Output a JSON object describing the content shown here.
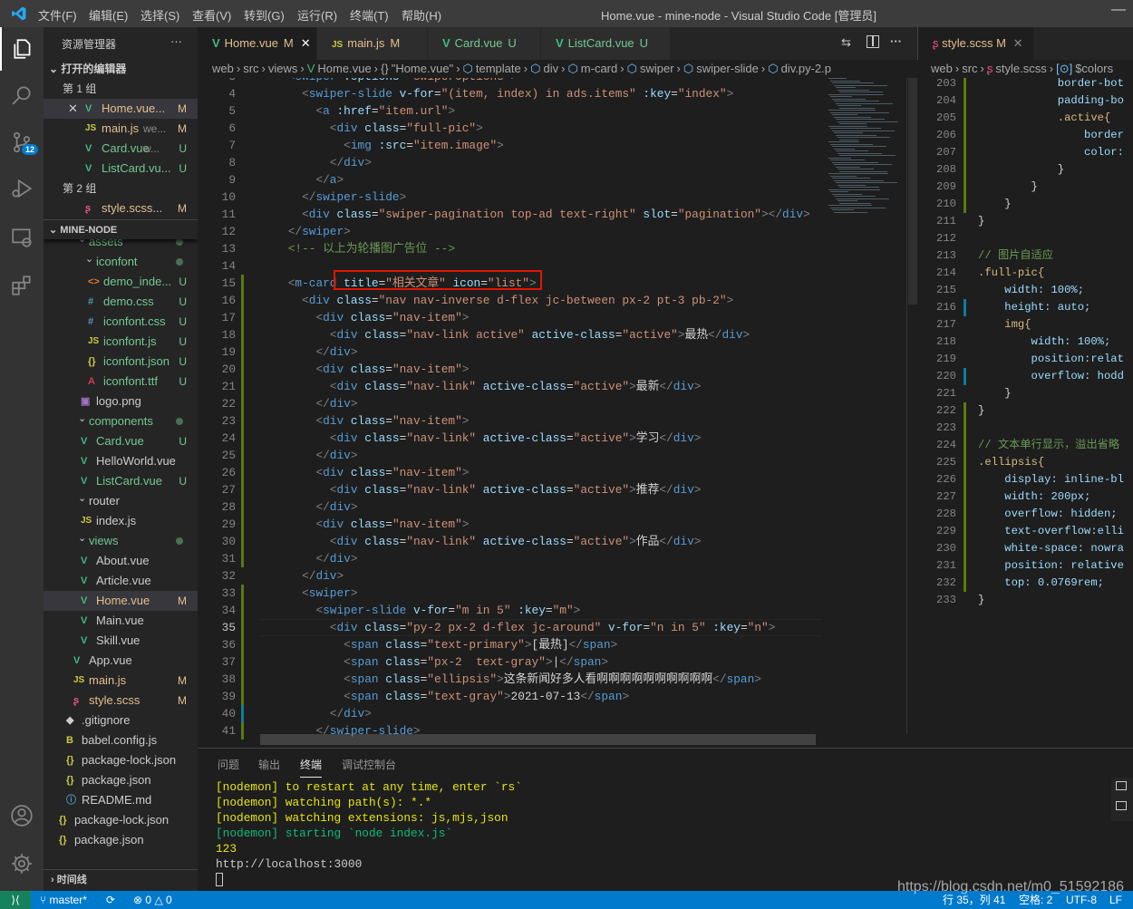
{
  "titlebar": {
    "title": "Home.vue - mine-node - Visual Studio Code [管理员]",
    "menus": [
      "文件(F)",
      "编辑(E)",
      "选择(S)",
      "查看(V)",
      "转到(G)",
      "运行(R)",
      "终端(T)",
      "帮助(H)"
    ]
  },
  "activity": {
    "scm_badge": "12"
  },
  "sidebar": {
    "title": "资源管理器",
    "more": "···",
    "open_editors_title": "打开的编辑器",
    "groups": [
      {
        "label": "第 1 组",
        "items": [
          {
            "label": "Home.vue...",
            "desc": "",
            "icon": "vue",
            "status": "M",
            "color": "mod",
            "active": true
          },
          {
            "label": "main.js",
            "desc": "we...",
            "icon": "js",
            "status": "M",
            "color": "mod"
          },
          {
            "label": "Card.vue",
            "desc": "w...",
            "icon": "vue",
            "status": "U",
            "color": "unt"
          },
          {
            "label": "ListCard.vu...",
            "desc": "",
            "icon": "vue",
            "status": "U",
            "color": "unt"
          }
        ]
      },
      {
        "label": "第 2 组",
        "items": [
          {
            "label": "style.scss...",
            "desc": "",
            "icon": "scss",
            "status": "M",
            "color": "mod"
          }
        ]
      }
    ],
    "project_title": "MINE-NODE",
    "tree": [
      {
        "label": "assets",
        "depth": 1,
        "folder": true,
        "status": "dot",
        "color": "unt"
      },
      {
        "label": "iconfont",
        "depth": 2,
        "folder": true,
        "status": "dot",
        "color": "unt"
      },
      {
        "label": "demo_inde...",
        "depth": 3,
        "icon": "html",
        "status": "U",
        "color": "unt"
      },
      {
        "label": "demo.css",
        "depth": 3,
        "icon": "css",
        "status": "U",
        "color": "unt"
      },
      {
        "label": "iconfont.css",
        "depth": 3,
        "icon": "css",
        "status": "U",
        "color": "unt"
      },
      {
        "label": "iconfont.js",
        "depth": 3,
        "icon": "js",
        "status": "U",
        "color": "unt"
      },
      {
        "label": "iconfont.json",
        "depth": 3,
        "icon": "json",
        "status": "U",
        "color": "unt"
      },
      {
        "label": "iconfont.ttf",
        "depth": 3,
        "icon": "font",
        "status": "U",
        "color": "unt"
      },
      {
        "label": "logo.png",
        "depth": 2,
        "icon": "img",
        "status": "",
        "color": ""
      },
      {
        "label": "components",
        "depth": 1,
        "folder": true,
        "status": "dot",
        "color": "unt"
      },
      {
        "label": "Card.vue",
        "depth": 2,
        "icon": "vue",
        "status": "U",
        "color": "unt"
      },
      {
        "label": "HelloWorld.vue",
        "depth": 2,
        "icon": "vue",
        "status": "",
        "color": ""
      },
      {
        "label": "ListCard.vue",
        "depth": 2,
        "icon": "vue",
        "status": "U",
        "color": "unt"
      },
      {
        "label": "router",
        "depth": 1,
        "folder": true,
        "status": "",
        "color": ""
      },
      {
        "label": "index.js",
        "depth": 2,
        "icon": "js",
        "status": "",
        "color": ""
      },
      {
        "label": "views",
        "depth": 1,
        "folder": true,
        "status": "dot",
        "color": "unt"
      },
      {
        "label": "About.vue",
        "depth": 2,
        "icon": "vue",
        "status": "",
        "color": ""
      },
      {
        "label": "Article.vue",
        "depth": 2,
        "icon": "vue",
        "status": "",
        "color": ""
      },
      {
        "label": "Home.vue",
        "depth": 2,
        "icon": "vue",
        "status": "M",
        "color": "mod",
        "selected": true
      },
      {
        "label": "Main.vue",
        "depth": 2,
        "icon": "vue",
        "status": "",
        "color": ""
      },
      {
        "label": "Skill.vue",
        "depth": 2,
        "icon": "vue",
        "status": "",
        "color": ""
      },
      {
        "label": "App.vue",
        "depth": 1,
        "icon": "vue",
        "status": "",
        "color": ""
      },
      {
        "label": "main.js",
        "depth": 1,
        "icon": "js",
        "status": "M",
        "color": "mod"
      },
      {
        "label": "style.scss",
        "depth": 1,
        "icon": "scss",
        "status": "M",
        "color": "mod"
      },
      {
        "label": ".gitignore",
        "depth": 0,
        "icon": "git",
        "status": "",
        "color": ""
      },
      {
        "label": "babel.config.js",
        "depth": 0,
        "icon": "babel",
        "status": "",
        "color": ""
      },
      {
        "label": "package-lock.json",
        "depth": 0,
        "icon": "json",
        "status": "",
        "color": ""
      },
      {
        "label": "package.json",
        "depth": 0,
        "icon": "json",
        "status": "",
        "color": ""
      },
      {
        "label": "README.md",
        "depth": 0,
        "icon": "md",
        "status": "",
        "color": ""
      },
      {
        "label": "package-lock.json",
        "depth": -1,
        "icon": "json",
        "status": "",
        "color": ""
      },
      {
        "label": "package.json",
        "depth": -1,
        "icon": "json",
        "status": "",
        "color": ""
      }
    ],
    "timeline_title": "时间线"
  },
  "editor1": {
    "tabs": [
      {
        "label": "Home.vue",
        "status": "M",
        "icon": "vue",
        "color": "mod",
        "active": true
      },
      {
        "label": "main.js",
        "status": "M",
        "icon": "js",
        "color": "mod"
      },
      {
        "label": "Card.vue",
        "status": "U",
        "icon": "vue",
        "color": "unt"
      },
      {
        "label": "ListCard.vue",
        "status": "U",
        "icon": "vue",
        "color": "unt"
      }
    ],
    "breadcrumbs": [
      "web",
      "src",
      "views",
      "Home.vue",
      "\"Home.vue\"",
      "template",
      "div",
      "m-card",
      "swiper",
      "swiper-slide",
      "div.py-2.p"
    ],
    "first_line": 3,
    "current_line": 35,
    "lines": [
      "    <swiper :options=\"swiperOptions\">",
      "      <swiper-slide v-for=\"(item, index) in ads.items\" :key=\"index\">",
      "        <a :href=\"item.url\">",
      "          <div class=\"full-pic\">",
      "            <img :src=\"item.image\">",
      "          </div>",
      "        </a>",
      "      </swiper-slide>",
      "      <div class=\"swiper-pagination top-ad text-right\" slot=\"pagination\"></div>",
      "    </swiper>",
      "    <!-- 以上为轮播图广告位 -->",
      "",
      "    <m-card title=\"相关文章\" icon=\"list\">",
      "      <div class=\"nav nav-inverse d-flex jc-between px-2 pt-3 pb-2\">",
      "        <div class=\"nav-item\">",
      "          <div class=\"nav-link active\" active-class=\"active\">最热</div>",
      "        </div>",
      "        <div class=\"nav-item\">",
      "          <div class=\"nav-link\" active-class=\"active\">最新</div>",
      "        </div>",
      "        <div class=\"nav-item\">",
      "          <div class=\"nav-link\" active-class=\"active\">学习</div>",
      "        </div>",
      "        <div class=\"nav-item\">",
      "          <div class=\"nav-link\" active-class=\"active\">推荐</div>",
      "        </div>",
      "        <div class=\"nav-item\">",
      "          <div class=\"nav-link\" active-class=\"active\">作品</div>",
      "        </div>",
      "      </div>",
      "      <swiper>",
      "        <swiper-slide v-for=\"m in 5\" :key=\"m\">",
      "          <div class=\"py-2 px-2 d-flex jc-around\" v-for=\"n in 5\" :key=\"n\">",
      "            <span class=\"text-primary\">[最热]</span>",
      "            <span class=\"px-2  text-gray\">|</span>",
      "            <span class=\"ellipsis\">这条新闻好多人看啊啊啊啊啊啊啊啊啊啊</span>",
      "            <span class=\"text-gray\">2021-07-13</span>",
      "          </div>",
      "        </swiper-slide>"
    ],
    "highlight_box_text": " title=\"相关文章\" icon=\"list\">",
    "highlight_color": "#e51400"
  },
  "editor2": {
    "tab": {
      "label": "style.scss",
      "status": "M",
      "icon": "scss",
      "color": "mod"
    },
    "breadcrumbs": [
      "web",
      "src",
      "style.scss",
      "$colors"
    ],
    "first_line": 203,
    "lines": [
      "            border-bot",
      "            padding-bo",
      "            .active{",
      "                border",
      "                color:",
      "            }",
      "        }",
      "    }",
      "}",
      "",
      "// 图片自适应",
      ".full-pic{",
      "    width: 100%;",
      "    height: auto;",
      "    img{",
      "        width: 100%;",
      "        position:relat",
      "        overflow: hodd",
      "    }",
      "}",
      "",
      "// 文本单行显示，溢出省略",
      ".ellipsis{",
      "    display: inline-bl",
      "    width: 200px;",
      "    overflow: hidden;",
      "    text-overflow:elli",
      "    white-space: nowra",
      "    position: relative",
      "    top: 0.0769rem;",
      "}"
    ]
  },
  "panel": {
    "tabs": [
      "问题",
      "输出",
      "终端",
      "调试控制台"
    ],
    "active_tab": "终端",
    "terminal": [
      {
        "text": "[nodemon] to restart at any time, enter `rs`",
        "color": "#e5e510"
      },
      {
        "text": "[nodemon] watching path(s): *.*",
        "color": "#e5e510"
      },
      {
        "text": "[nodemon] watching extensions: js,mjs,json",
        "color": "#e5e510"
      },
      {
        "text": "[nodemon] starting `node index.js`",
        "color": "#0dbc79"
      },
      {
        "text": "123",
        "color": "#e5e510"
      },
      {
        "text": "http://localhost:3000",
        "color": "#cccccc"
      }
    ]
  },
  "status": {
    "branch": "master*",
    "errors": "0",
    "warnings": "0",
    "position": "行 35，列 41",
    "spaces": "空格: 2",
    "encoding": "UTF-8",
    "eol": "LF",
    "watermark": "https://blog.csdn.net/m0_51592186"
  },
  "colors": {
    "accent": "#007acc",
    "modified": "#e2c08d",
    "untracked": "#73c991"
  }
}
